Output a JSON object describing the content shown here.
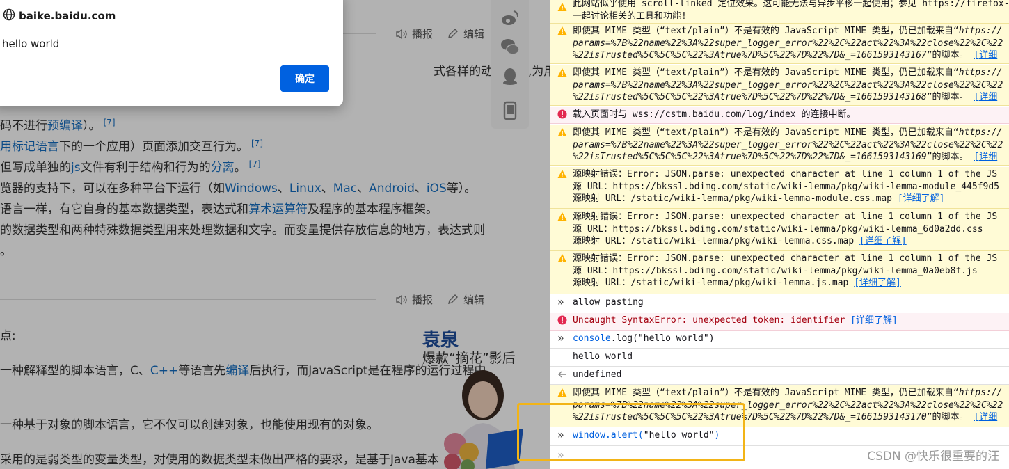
{
  "dialog": {
    "host": "baike.baidu.com",
    "message": "hello world",
    "ok_label": "确定"
  },
  "page": {
    "broadcast_label": "播报",
    "edit_label": "编辑",
    "lines": [
      "式各样的动态功能,为用户提",
      "码不进行",
      "预编译",
      "）。",
      "用标记语言",
      "下的一个应用）页面添加交互行为。",
      "但写成单独的",
      "js",
      "文件有利于结构和行为的",
      "分离",
      "。",
      "览器的支持下，可以在多种平台下运行（如",
      "Windows",
      "、",
      "Linux",
      "、",
      "Mac",
      "、",
      "Android",
      "、",
      "iOS",
      "等）。",
      "语言一样，有它自身的基本数据类型，表达式和",
      "算术运算符",
      "及程序的基本程序框架。",
      "的数据类型和两种特殊数据类型用来处理数据和文字。而变量提供存放信息的地方，表达式则",
      "。",
      "点:",
      "一种解释型的脚本语言，C、",
      "C++",
      "等语言先",
      "编译",
      "后执行，而JavaScript是在程序的运行过程中",
      "一种基于对象的脚本语言，它不仅可以创建对象，也能使用现有的对象。",
      "采用的是弱类型的变量类型，对使用的数据类型未做出严格的要求，是基于Java基本"
    ],
    "ref": "[7]",
    "ad_title": "袁泉",
    "ad_subtitle": "爆款“摘花”影后"
  },
  "console": {
    "top_line1": "此网站似乎使用 scroll-linked 定位效果。这可能无法与异步平移一起使用；参见 https://firefox-",
    "top_line2": "一起讨论相关的工具和功能!",
    "warn_prefix": "即使其 MIME 类型（“text/plain”）不是有效的 JavaScript MIME 类型，仍已加载来自“",
    "warn_url1": "https://",
    "warn_params": "params=%7B%22name%22%3A%22super_logger_error%22%2C%22act%22%3A%22close%22%2C%22",
    "warn_tail_167": "%22isTrusted%5C%5C%5C%22%3Atrue%7D%5C%22%7D%22%7D&_=1661593143167",
    "warn_tail_168": "%22isTrusted%5C%5C%5C%22%3Atrue%7D%5C%22%7D%22%7D&_=1661593143168",
    "warn_tail_169": "%22isTrusted%5C%5C%5C%22%3Atrue%7D%5C%22%7D%22%7D&_=1661593143169",
    "warn_tail_170": "%22isTrusted%5C%5C%5C%22%3Atrue%7D%5C%22%7D%22%7D&_=1661593143170",
    "warn_suffix": "”的脚本。",
    "learn_more": "[详细",
    "learn_more_full": "[详细了解]",
    "ws_error_prefix": "载入页面时与 ",
    "ws_error_url": "wss://cstm.baidu.com/log/index",
    "ws_error_suffix": " 的连接中断。",
    "sm_error": "源映射错误：Error: JSON.parse: unexpected character at line 1 column 1 of the JS",
    "src_prefix": "源 URL：",
    "src1": "https://bkssl.bdimg.com/static/wiki-lemma/pkg/wiki-lemma-module_445f9d5",
    "map1": "/static/wiki-lemma/pkg/wiki-lemma-module.css.map",
    "src2": "https://bkssl.bdimg.com/static/wiki-lemma/pkg/wiki-lemma_6d0a2dd.css",
    "map2": "/static/wiki-lemma/pkg/wiki-lemma.css.map",
    "src3": "https://bkssl.bdimg.com/static/wiki-lemma/pkg/wiki-lemma_0a0eb8f.js",
    "map3": "/static/wiki-lemma/pkg/wiki-lemma.js.map",
    "map_prefix": "源映射 URL：",
    "allow_pasting": "allow pasting",
    "uncaught": "Uncaught SyntaxError: unexpected token: identifier",
    "cmd_log_fn": "console",
    "cmd_log_dot": ".log(",
    "cmd_log_arg": "\"hello world\"",
    "cmd_close": ")",
    "log_output": "hello world",
    "undefined": "undefined",
    "cmd_alert_fn": "window",
    "cmd_alert_dot": ".alert(",
    "cmd_alert_arg": "\"hello world\"",
    "prompt": "»",
    "watermark": "CSDN @快乐很重要的汪"
  },
  "colors": {
    "warn_bg": "#fffbd6",
    "error_bg": "#fdf2f5",
    "link": "#0060df",
    "highlight": "#f2b417",
    "ok_button": "#0061e0"
  }
}
